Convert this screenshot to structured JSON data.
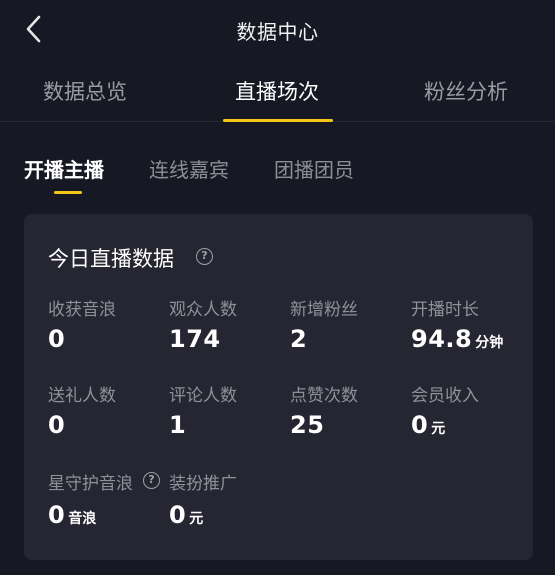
{
  "header": {
    "title": "数据中心",
    "back_icon": "chevron-left-icon"
  },
  "top_tabs": [
    {
      "label": "数据总览",
      "active": false
    },
    {
      "label": "直播场次",
      "active": true
    },
    {
      "label": "粉丝分析",
      "active": false
    }
  ],
  "sub_tabs": [
    {
      "label": "开播主播",
      "active": true
    },
    {
      "label": "连线嘉宾",
      "active": false
    },
    {
      "label": "团播团员",
      "active": false
    }
  ],
  "card": {
    "title": "今日直播数据",
    "help_icon": "question-circle-icon",
    "stats": [
      {
        "label": "收获音浪",
        "value": "0",
        "unit": ""
      },
      {
        "label": "观众人数",
        "value": "174",
        "unit": ""
      },
      {
        "label": "新增粉丝",
        "value": "2",
        "unit": ""
      },
      {
        "label": "开播时长",
        "value": "94.8",
        "unit": "分钟"
      },
      {
        "label": "送礼人数",
        "value": "0",
        "unit": ""
      },
      {
        "label": "评论人数",
        "value": "1",
        "unit": ""
      },
      {
        "label": "点赞次数",
        "value": "25",
        "unit": ""
      },
      {
        "label": "会员收入",
        "value": "0",
        "unit": "元"
      },
      {
        "label": "星守护音浪",
        "value": "0",
        "unit": "音浪"
      },
      {
        "label": "装扮推广",
        "value": "0",
        "unit": "元"
      }
    ]
  },
  "colors": {
    "background": "#161823",
    "card": "#252632",
    "accent": "#f5c518",
    "muted_text": "#8f9098"
  }
}
